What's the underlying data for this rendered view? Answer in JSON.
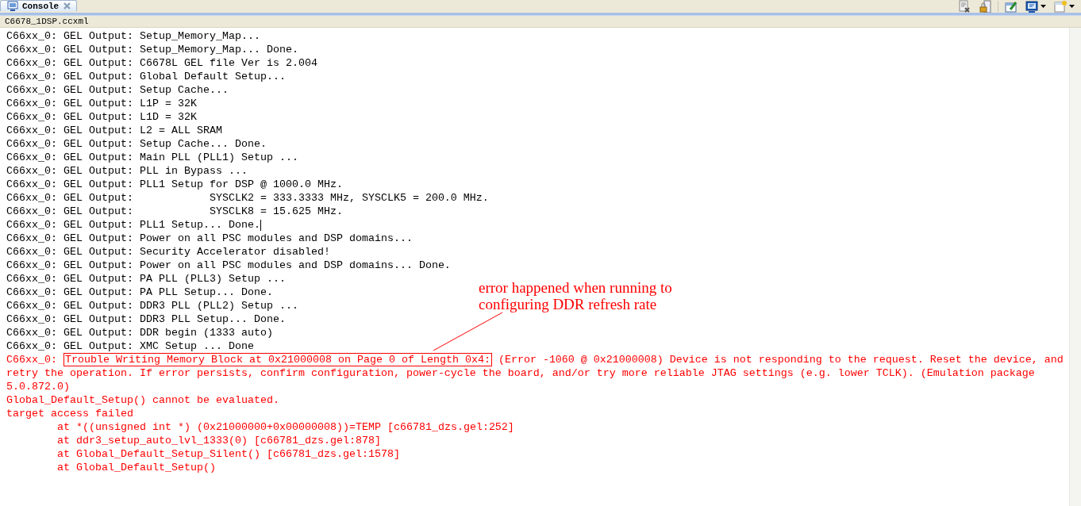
{
  "tab": {
    "label": "Console",
    "selected": true
  },
  "console_title": "C6678_1DSP.ccxml",
  "lines": [
    {
      "kind": "normal",
      "text": "C66xx_0: GEL Output: Setup_Memory_Map..."
    },
    {
      "kind": "normal",
      "text": "C66xx_0: GEL Output: Setup_Memory_Map... Done."
    },
    {
      "kind": "normal",
      "text": "C66xx_0: GEL Output: C6678L GEL file Ver is 2.004"
    },
    {
      "kind": "normal",
      "text": "C66xx_0: GEL Output: Global Default Setup..."
    },
    {
      "kind": "normal",
      "text": "C66xx_0: GEL Output: Setup Cache..."
    },
    {
      "kind": "normal",
      "text": "C66xx_0: GEL Output: L1P = 32K"
    },
    {
      "kind": "normal",
      "text": "C66xx_0: GEL Output: L1D = 32K"
    },
    {
      "kind": "normal",
      "text": "C66xx_0: GEL Output: L2 = ALL SRAM"
    },
    {
      "kind": "normal",
      "text": "C66xx_0: GEL Output: Setup Cache... Done."
    },
    {
      "kind": "normal",
      "text": "C66xx_0: GEL Output: Main PLL (PLL1) Setup ..."
    },
    {
      "kind": "normal",
      "text": "C66xx_0: GEL Output: PLL in Bypass ..."
    },
    {
      "kind": "normal",
      "text": "C66xx_0: GEL Output: PLL1 Setup for DSP @ 1000.0 MHz."
    },
    {
      "kind": "normal",
      "text": "C66xx_0: GEL Output:            SYSCLK2 = 333.3333 MHz, SYSCLK5 = 200.0 MHz."
    },
    {
      "kind": "normal",
      "text": "C66xx_0: GEL Output:            SYSCLK8 = 15.625 MHz."
    },
    {
      "kind": "normal",
      "text": "C66xx_0: GEL Output: PLL1 Setup... Done.",
      "cursor": true
    },
    {
      "kind": "normal",
      "text": "C66xx_0: GEL Output: Power on all PSC modules and DSP domains..."
    },
    {
      "kind": "normal",
      "text": "C66xx_0: GEL Output: Security Accelerator disabled!"
    },
    {
      "kind": "normal",
      "text": "C66xx_0: GEL Output: Power on all PSC modules and DSP domains... Done."
    },
    {
      "kind": "normal",
      "text": "C66xx_0: GEL Output: PA PLL (PLL3) Setup ..."
    },
    {
      "kind": "normal",
      "text": "C66xx_0: GEL Output: PA PLL Setup... Done."
    },
    {
      "kind": "normal",
      "text": "C66xx_0: GEL Output: DDR3 PLL (PLL2) Setup ..."
    },
    {
      "kind": "normal",
      "text": "C66xx_0: GEL Output: DDR3 PLL Setup... Done."
    },
    {
      "kind": "normal",
      "text": "C66xx_0: GEL Output: DDR begin (1333 auto)"
    },
    {
      "kind": "normal",
      "text": "C66xx_0: GEL Output: XMC Setup ... Done"
    },
    {
      "kind": "boxed_error",
      "prefix": "C66xx_0:",
      "boxed": "Trouble Writing Memory Block at 0x21000008 on Page 0 of Length 0x4:",
      "text": "(Error -1060 @ 0x21000008) Device is not responding to the request. Reset the device, and retry the operation. If error persists, confirm configuration, power-cycle the board, and/or try more reliable JTAG settings (e.g. lower TCLK). (Emulation package 5.0.872.0)"
    },
    {
      "kind": "error",
      "text": "Global_Default_Setup() cannot be evaluated."
    },
    {
      "kind": "error",
      "text": "target access failed"
    },
    {
      "kind": "error",
      "text": "        at *((unsigned int *) (0x21000000+0x00000008))=TEMP [c66781_dzs.gel:252]"
    },
    {
      "kind": "error",
      "text": "        at ddr3_setup_auto_lvl_1333(0) [c66781_dzs.gel:878]"
    },
    {
      "kind": "error",
      "text": "        at Global_Default_Setup_Silent() [c66781_dzs.gel:1578]"
    },
    {
      "kind": "error",
      "text": "        at Global_Default_Setup()"
    }
  ],
  "annotation": {
    "lines": [
      "error happened when running to",
      "configuring DDR refresh rate"
    ]
  }
}
